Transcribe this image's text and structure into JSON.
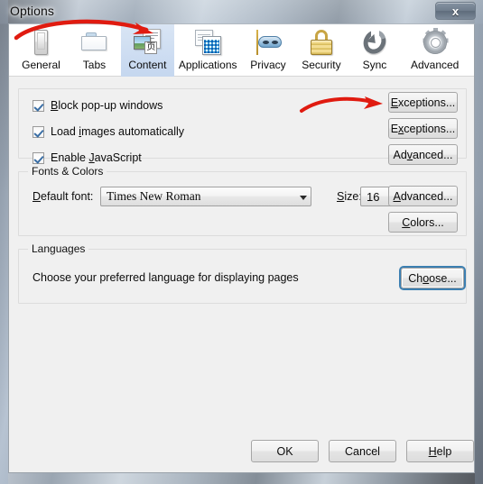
{
  "window": {
    "title": "Options",
    "close_label": "x",
    "close_icon": "close-icon"
  },
  "tabs": [
    {
      "label": "General",
      "icon": "device-icon",
      "selected": false
    },
    {
      "label": "Tabs",
      "icon": "browser-tabs-icon",
      "selected": false
    },
    {
      "label": "Content",
      "icon": "content-page-icon",
      "selected": true
    },
    {
      "label": "Applications",
      "icon": "applications-icon",
      "selected": false
    },
    {
      "label": "Privacy",
      "icon": "mask-icon",
      "selected": false
    },
    {
      "label": "Security",
      "icon": "padlock-icon",
      "selected": false
    },
    {
      "label": "Sync",
      "icon": "sync-arrows-icon",
      "selected": false
    },
    {
      "label": "Advanced",
      "icon": "gear-icon",
      "selected": false
    }
  ],
  "content": {
    "popups_group": {
      "checkboxes": [
        {
          "label_pre": "",
          "accesskey": "B",
          "label_post": "lock pop-up windows",
          "checked": true
        },
        {
          "label_pre": "Load ",
          "accesskey": "i",
          "label_post": "mages automatically",
          "checked": true
        },
        {
          "label_pre": "Enable ",
          "accesskey": "J",
          "label_post": "avaScript",
          "checked": true
        }
      ],
      "buttons": [
        {
          "label_pre": "",
          "accesskey": "E",
          "label_post": "xceptions...",
          "focused": false
        },
        {
          "label_pre": "E",
          "accesskey": "x",
          "label_post": "ceptions...",
          "focused": false
        },
        {
          "label_pre": "Ad",
          "accesskey": "v",
          "label_post": "anced...",
          "focused": false
        }
      ]
    },
    "fonts_group": {
      "title": "Fonts & Colors",
      "default_font_label_pre": "",
      "default_font_accesskey": "D",
      "default_font_label_post": "efault font:",
      "default_font_value": "Times New Roman",
      "size_label_pre": "",
      "size_accesskey": "S",
      "size_label_post": "ize:",
      "size_value": "16",
      "buttons": [
        {
          "label_pre": "",
          "accesskey": "A",
          "label_post": "dvanced..."
        },
        {
          "label_pre": "",
          "accesskey": "C",
          "label_post": "olors..."
        }
      ]
    },
    "languages_group": {
      "title": "Languages",
      "description": "Choose your preferred language for displaying pages",
      "button": {
        "label_pre": "Ch",
        "accesskey": "o",
        "label_post": "ose...",
        "focused": true
      }
    }
  },
  "footer": {
    "buttons": [
      {
        "label_pre": "OK",
        "accesskey": "",
        "label_post": ""
      },
      {
        "label_pre": "Cancel",
        "accesskey": "",
        "label_post": ""
      },
      {
        "label_pre": "",
        "accesskey": "H",
        "label_post": "elp"
      }
    ]
  },
  "annotations": {
    "color": "#e01b10",
    "arrows": [
      {
        "name": "arrow-to-content-tab",
        "points_to": "Content"
      },
      {
        "name": "arrow-to-exceptions-button",
        "points_to": "Exceptions..."
      }
    ]
  }
}
